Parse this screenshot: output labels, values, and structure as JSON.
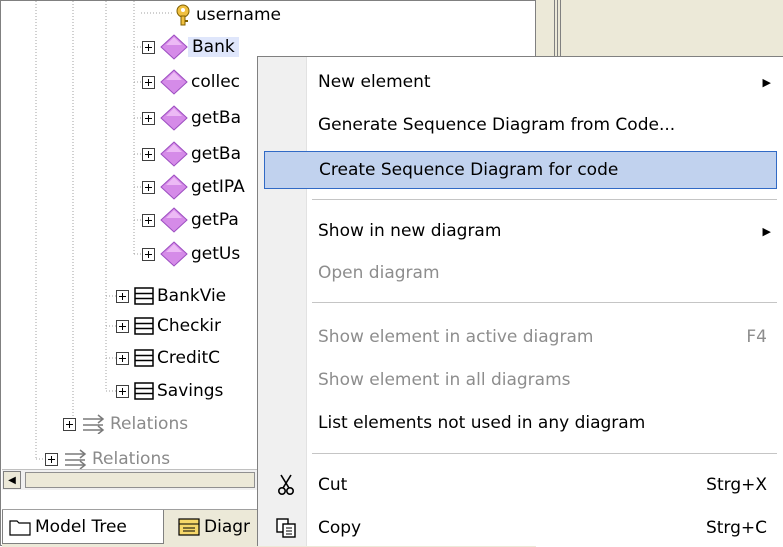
{
  "tree": {
    "nodes": [
      {
        "label": "username"
      },
      {
        "label": "Bank"
      },
      {
        "label": "collec"
      },
      {
        "label": "getBa"
      },
      {
        "label": "getBa"
      },
      {
        "label": "getIPA"
      },
      {
        "label": "getPa"
      },
      {
        "label": "getUs"
      },
      {
        "label": "BankVie"
      },
      {
        "label": "Checkir"
      },
      {
        "label": "CreditC"
      },
      {
        "label": "Savings"
      },
      {
        "label": "Relations"
      },
      {
        "label": "Relations"
      }
    ]
  },
  "tabs": [
    {
      "label": "Model Tree"
    },
    {
      "label": "Diagr"
    }
  ],
  "context_menu": {
    "items": [
      {
        "label": "New element",
        "enabled": true,
        "submenu": true
      },
      {
        "label": "Generate Sequence Diagram from Code...",
        "enabled": true
      },
      {
        "label": "Create Sequence Diagram for code",
        "enabled": true,
        "highlighted": true
      },
      {
        "label": "Show in new diagram",
        "enabled": true,
        "submenu": true
      },
      {
        "label": "Open diagram",
        "enabled": false
      },
      {
        "label": "Show element in active diagram",
        "enabled": false,
        "shortcut": "F4"
      },
      {
        "label": "Show element in all diagrams",
        "enabled": false
      },
      {
        "label": "List elements not used in any diagram",
        "enabled": true
      },
      {
        "label": "Cut",
        "enabled": true,
        "shortcut": "Strg+X",
        "icon": "scissors-icon"
      },
      {
        "label": "Copy",
        "enabled": true,
        "shortcut": "Strg+C",
        "icon": "copy-icon"
      }
    ]
  },
  "colors": {
    "highlight_bg": "#c1d2ee",
    "highlight_border": "#316ac5",
    "operation_icon": "#d58be8",
    "disabled_text": "#8d8d8d"
  }
}
